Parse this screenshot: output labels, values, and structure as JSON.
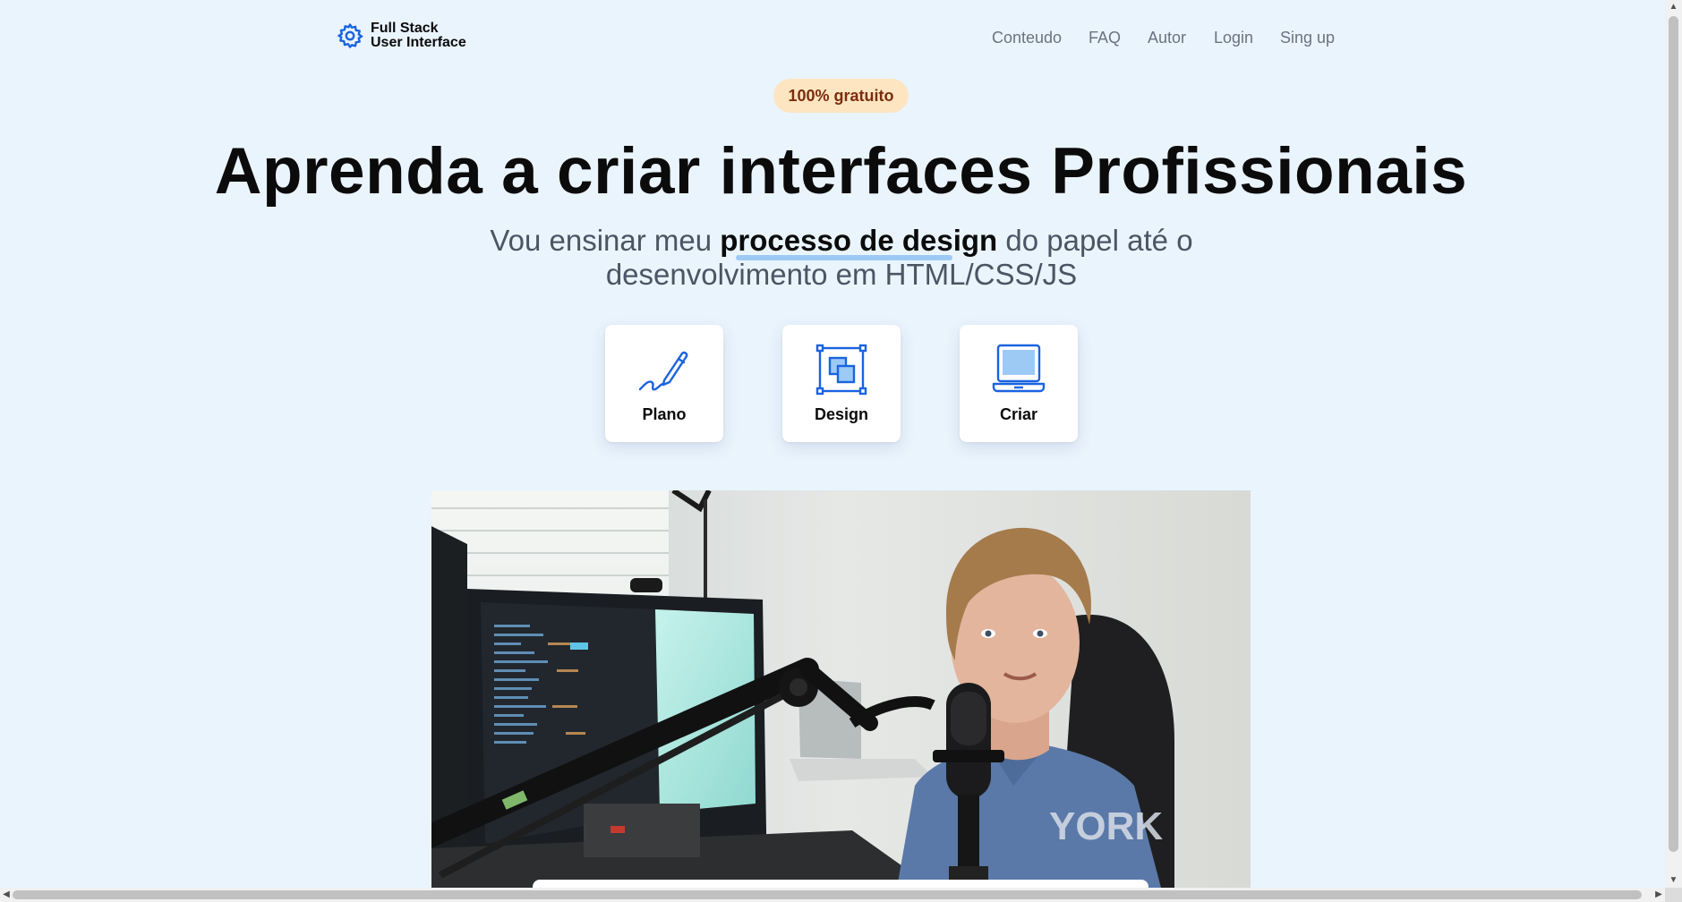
{
  "brand": {
    "line1": "Full Stack",
    "line2": "User Interface",
    "icon": "gear-icon",
    "color": "#1a63e0"
  },
  "nav": {
    "items": [
      "Conteudo",
      "FAQ",
      "Autor",
      "Login",
      "Sing up"
    ]
  },
  "badge": "100% gratuito",
  "hero": {
    "title": "Aprenda a criar interfaces Profissionais",
    "sub_before": "Vou ensinar meu ",
    "sub_highlight": "processo de design",
    "sub_after": " do papel até o desenvolvimento em HTML/CSS/JS"
  },
  "cards": [
    {
      "label": "Plano",
      "icon": "pen-icon"
    },
    {
      "label": "Design",
      "icon": "frame-icon"
    },
    {
      "label": "Criar",
      "icon": "laptop-icon"
    }
  ],
  "colors": {
    "background": "#eaf4fd",
    "accent": "#1a63e0",
    "badge_bg": "#fde5c2",
    "badge_text": "#7a2e0e",
    "highlight": "#9ccaf5"
  }
}
